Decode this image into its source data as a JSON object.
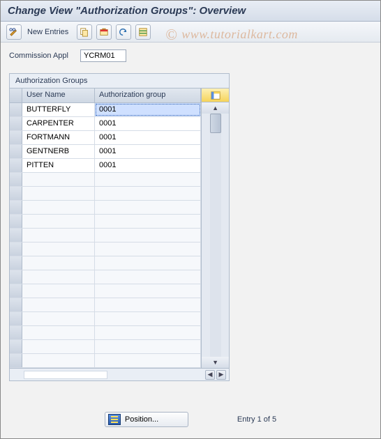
{
  "title": "Change View \"Authorization Groups\": Overview",
  "watermark": "www.tutorialkart.com",
  "toolbar": {
    "new_entries_label": "New Entries",
    "icons": {
      "toggle": "toggle-display-change-icon",
      "copy": "copy-as-icon",
      "delete": "delete-icon",
      "undo": "undo-change-icon",
      "select_all": "select-all-icon"
    }
  },
  "fields": {
    "commission_appl_label": "Commission Appl",
    "commission_appl_value": "YCRM01"
  },
  "panel": {
    "title": "Authorization Groups",
    "columns": {
      "user": "User Name",
      "auth": "Authorization group"
    },
    "rows": [
      {
        "user": "BUTTERFLY",
        "auth": "0001",
        "auth_selected": true
      },
      {
        "user": "CARPENTER",
        "auth": "0001"
      },
      {
        "user": "FORTMANN",
        "auth": "0001"
      },
      {
        "user": "GENTNERB",
        "auth": "0001"
      },
      {
        "user": "PITTEN",
        "auth": "0001"
      }
    ],
    "empty_rows": 14
  },
  "footer": {
    "position_label": "Position...",
    "entry_text": "Entry 1 of 5"
  }
}
